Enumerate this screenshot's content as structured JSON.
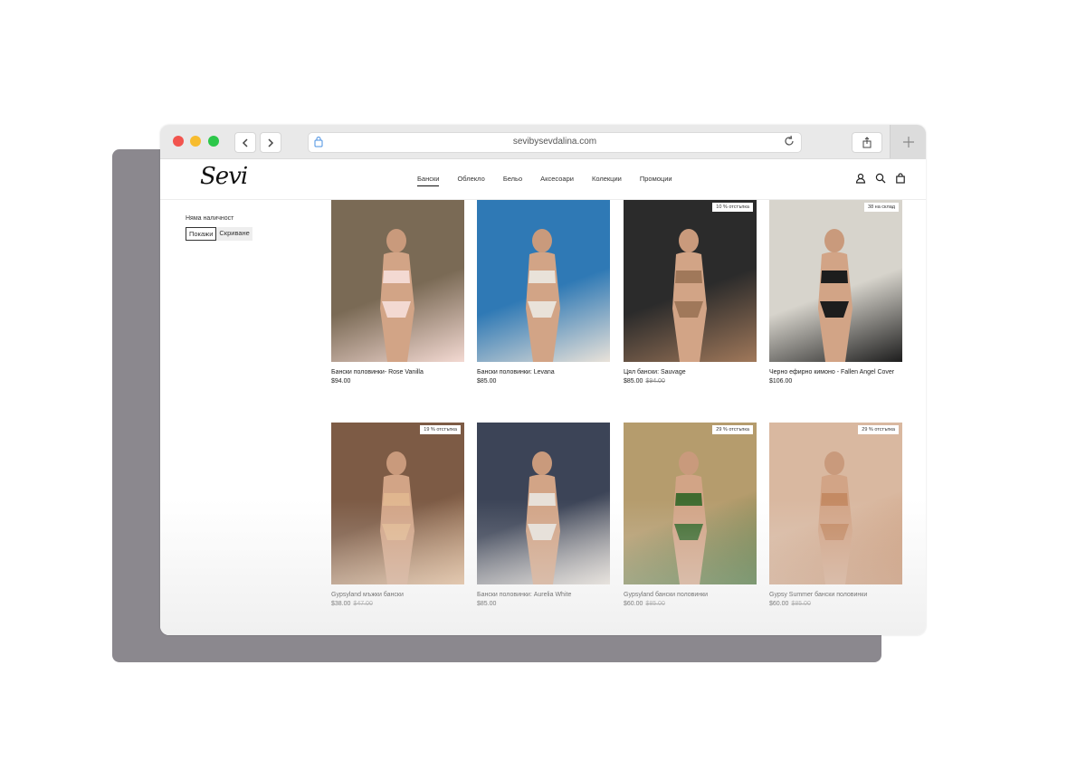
{
  "browser": {
    "url": "sevibysevdalina.com"
  },
  "header": {
    "logo": "Sevi",
    "menu": [
      "Бански",
      "Облекло",
      "Бельо",
      "Аксесоари",
      "Колекции",
      "Промоции"
    ],
    "active_menu": "Бански",
    "icons": [
      "account-icon",
      "search-icon",
      "cart-icon"
    ]
  },
  "sidebar": {
    "stock_label": "Няма наличност",
    "show_label": "Покажи",
    "hide_label": "Скриване"
  },
  "products": [
    {
      "name": "Бански половинки- Rose Vanilla",
      "price": "$94.00",
      "old_price": "",
      "badge": "",
      "bg": "#7a6a55",
      "accent": "#f3d9d2"
    },
    {
      "name": "Бански половинки: Levana",
      "price": "$85.00",
      "old_price": "",
      "badge": "",
      "bg": "#2f79b5",
      "accent": "#e9e2d9"
    },
    {
      "name": "Цял бански: Sauvage",
      "price": "$85.00",
      "old_price": "$94.00",
      "badge": "10 % отстъпка",
      "bg": "#2b2b2b",
      "accent": "#a0785a"
    },
    {
      "name": "Черно ефирно кимоно - Fallen Angel Cover",
      "price": "$106.00",
      "old_price": "",
      "badge": "38 на склад",
      "bg": "#d7d4cc",
      "accent": "#1d1d1d"
    },
    {
      "name": "Gypsyland мъжки бански",
      "price": "$38.00",
      "old_price": "$47.00",
      "badge": "19 % отстъпка",
      "bg": "#7d5b45",
      "accent": "#e0b68f"
    },
    {
      "name": "Бански половинки: Aurelia White",
      "price": "$85.00",
      "old_price": "",
      "badge": "",
      "bg": "#3c4457",
      "accent": "#e7e0d8"
    },
    {
      "name": "Gypsyland бански половинки",
      "price": "$60.00",
      "old_price": "$85.00",
      "badge": "29 % отстъпка",
      "bg": "#b59c6d",
      "accent": "#3f6b2f"
    },
    {
      "name": "Gypsy Summer бански половинки",
      "price": "$60.00",
      "old_price": "$85.00",
      "badge": "29 % отстъпка",
      "bg": "#d9b8a0",
      "accent": "#c48a63"
    }
  ]
}
